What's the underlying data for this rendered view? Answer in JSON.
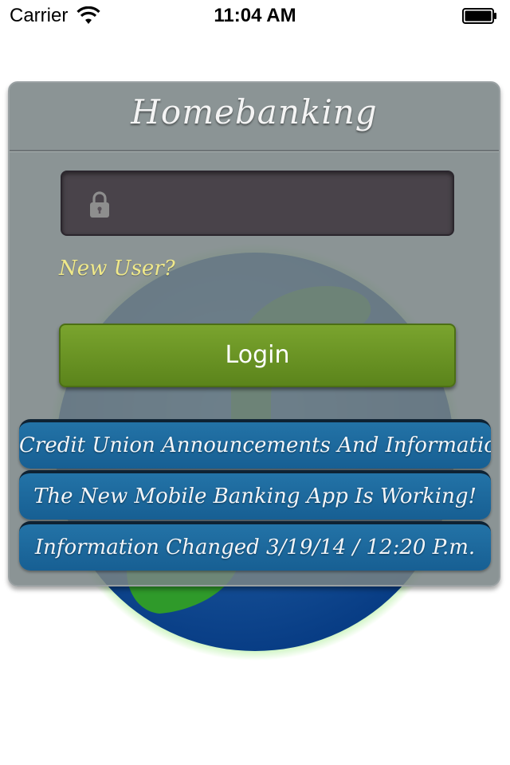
{
  "status_bar": {
    "carrier": "Carrier",
    "time": "11:04 AM",
    "icons": [
      "wifi-icon",
      "battery-icon"
    ]
  },
  "panel": {
    "title": "Homebanking",
    "password_field": {
      "value": "",
      "placeholder": "",
      "icon": "lock-icon"
    },
    "new_user_link": "New User?",
    "login_button": "Login"
  },
  "announcements": [
    {
      "text": "Credit Union Announcements And Information"
    },
    {
      "text": "The New Mobile Banking App Is Working!"
    },
    {
      "text": "Information Changed 3/19/14 / 12:20 P.m."
    }
  ],
  "colors": {
    "panel_bg": "#7e8789",
    "password_bg": "#463e46",
    "login_green": "#6a9424",
    "announcement_blue": "#1d6a9e",
    "new_user_yellow": "#f0e98a",
    "globe_glow": "#6ee04a",
    "globe_blue": "#0a3f82"
  }
}
